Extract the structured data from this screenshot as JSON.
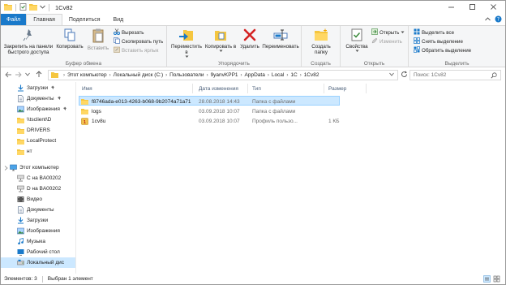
{
  "window": {
    "title": "1Cv82"
  },
  "tabs": {
    "file": "Файл",
    "home": "Главная",
    "share": "Поделиться",
    "view": "Вид"
  },
  "ribbon": {
    "clipboard": {
      "label": "Буфер обмена",
      "pin": "Закрепить на панели быстрого доступа",
      "copy": "Копировать",
      "paste": "Вставить",
      "cut": "Вырезать",
      "copy_path": "Скопировать путь",
      "paste_shortcut": "Вставить ярлык"
    },
    "organize": {
      "label": "Упорядочить",
      "move_to": "Переместить в",
      "copy_to": "Копировать в",
      "delete": "Удалить",
      "rename": "Переименовать"
    },
    "new": {
      "label": "Создать",
      "new_folder": "Создать папку"
    },
    "open": {
      "label": "Открыть",
      "properties": "Свойства",
      "open": "Открыть",
      "edit": "Изменить"
    },
    "select": {
      "label": "Выделить",
      "select_all": "Выделить все",
      "select_none": "Снять выделение",
      "invert": "Обратить выделение"
    }
  },
  "address": {
    "crumbs": [
      "Этот компьютер",
      "Локальный диск (C:)",
      "Пользователи",
      "9yanvKPP1",
      "AppData",
      "Local",
      "1C",
      "1Cv82"
    ],
    "search_placeholder": "Поиск: 1Cv82"
  },
  "nav": {
    "items": [
      {
        "label": "Загрузки",
        "icon": "download-icon",
        "pinned": true
      },
      {
        "label": "Документы",
        "icon": "documents-icon",
        "pinned": true
      },
      {
        "label": "Изображения",
        "icon": "pictures-icon",
        "pinned": true
      },
      {
        "label": "\\\\tsclient\\D",
        "icon": "folder-icon",
        "pinned": false
      },
      {
        "label": "DRIVERS",
        "icon": "folder-icon",
        "pinned": false
      },
      {
        "label": "LocalProtect",
        "icon": "folder-icon",
        "pinned": false
      },
      {
        "label": "нт",
        "icon": "folder-icon",
        "pinned": false
      },
      {
        "label": "Этот компьютер",
        "icon": "computer-icon",
        "pinned": false
      },
      {
        "label": "C на BA00202",
        "icon": "network-drive-icon",
        "pinned": false
      },
      {
        "label": "D на BA00202",
        "icon": "network-drive-icon",
        "pinned": false
      },
      {
        "label": "Видео",
        "icon": "video-icon",
        "pinned": false
      },
      {
        "label": "Документы",
        "icon": "documents-icon",
        "pinned": false
      },
      {
        "label": "Загрузки",
        "icon": "download-icon",
        "pinned": false
      },
      {
        "label": "Изображения",
        "icon": "pictures-icon",
        "pinned": false
      },
      {
        "label": "Музыка",
        "icon": "music-icon",
        "pinned": false
      },
      {
        "label": "Рабочий стол",
        "icon": "desktop-icon",
        "pinned": false
      },
      {
        "label": "Локальный дис",
        "icon": "local-disk-icon",
        "pinned": false
      }
    ]
  },
  "files": {
    "columns": {
      "name": "Имя",
      "date": "Дата изменения",
      "type": "Тип",
      "size": "Размер"
    },
    "rows": [
      {
        "name": "f8746ada-e013-4263-b068-9b2074a71a71",
        "date": "28.08.2018 14:43",
        "type": "Папка с файлами",
        "size": "",
        "icon": "folder-icon",
        "selected": true
      },
      {
        "name": "logs",
        "date": "03.09.2018 10:07",
        "type": "Папка с файлами",
        "size": "",
        "icon": "folder-icon",
        "selected": false
      },
      {
        "name": "1cv8u",
        "date": "03.09.2018 10:07",
        "type": "Профиль пользо...",
        "size": "1 КБ",
        "icon": "profile-file-icon",
        "selected": false
      }
    ]
  },
  "status": {
    "count": "Элементов: 3",
    "selected": "Выбран 1 элемент"
  },
  "colors": {
    "accent": "#1979ca",
    "selection": "#cce8ff",
    "folder": "#f5c640"
  }
}
